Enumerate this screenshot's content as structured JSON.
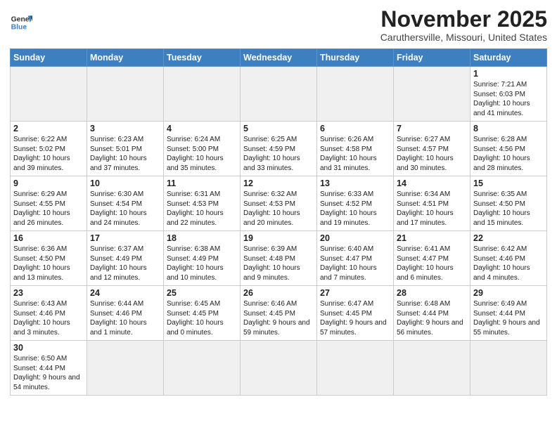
{
  "logo": {
    "line1": "General",
    "line2": "Blue"
  },
  "title": "November 2025",
  "subtitle": "Caruthersville, Missouri, United States",
  "weekdays": [
    "Sunday",
    "Monday",
    "Tuesday",
    "Wednesday",
    "Thursday",
    "Friday",
    "Saturday"
  ],
  "weeks": [
    [
      {
        "day": "",
        "info": ""
      },
      {
        "day": "",
        "info": ""
      },
      {
        "day": "",
        "info": ""
      },
      {
        "day": "",
        "info": ""
      },
      {
        "day": "",
        "info": ""
      },
      {
        "day": "",
        "info": ""
      },
      {
        "day": "1",
        "info": "Sunrise: 7:21 AM\nSunset: 6:03 PM\nDaylight: 10 hours\nand 41 minutes."
      }
    ],
    [
      {
        "day": "2",
        "info": "Sunrise: 6:22 AM\nSunset: 5:02 PM\nDaylight: 10 hours\nand 39 minutes."
      },
      {
        "day": "3",
        "info": "Sunrise: 6:23 AM\nSunset: 5:01 PM\nDaylight: 10 hours\nand 37 minutes."
      },
      {
        "day": "4",
        "info": "Sunrise: 6:24 AM\nSunset: 5:00 PM\nDaylight: 10 hours\nand 35 minutes."
      },
      {
        "day": "5",
        "info": "Sunrise: 6:25 AM\nSunset: 4:59 PM\nDaylight: 10 hours\nand 33 minutes."
      },
      {
        "day": "6",
        "info": "Sunrise: 6:26 AM\nSunset: 4:58 PM\nDaylight: 10 hours\nand 31 minutes."
      },
      {
        "day": "7",
        "info": "Sunrise: 6:27 AM\nSunset: 4:57 PM\nDaylight: 10 hours\nand 30 minutes."
      },
      {
        "day": "8",
        "info": "Sunrise: 6:28 AM\nSunset: 4:56 PM\nDaylight: 10 hours\nand 28 minutes."
      }
    ],
    [
      {
        "day": "9",
        "info": "Sunrise: 6:29 AM\nSunset: 4:55 PM\nDaylight: 10 hours\nand 26 minutes."
      },
      {
        "day": "10",
        "info": "Sunrise: 6:30 AM\nSunset: 4:54 PM\nDaylight: 10 hours\nand 24 minutes."
      },
      {
        "day": "11",
        "info": "Sunrise: 6:31 AM\nSunset: 4:53 PM\nDaylight: 10 hours\nand 22 minutes."
      },
      {
        "day": "12",
        "info": "Sunrise: 6:32 AM\nSunset: 4:53 PM\nDaylight: 10 hours\nand 20 minutes."
      },
      {
        "day": "13",
        "info": "Sunrise: 6:33 AM\nSunset: 4:52 PM\nDaylight: 10 hours\nand 19 minutes."
      },
      {
        "day": "14",
        "info": "Sunrise: 6:34 AM\nSunset: 4:51 PM\nDaylight: 10 hours\nand 17 minutes."
      },
      {
        "day": "15",
        "info": "Sunrise: 6:35 AM\nSunset: 4:50 PM\nDaylight: 10 hours\nand 15 minutes."
      }
    ],
    [
      {
        "day": "16",
        "info": "Sunrise: 6:36 AM\nSunset: 4:50 PM\nDaylight: 10 hours\nand 13 minutes."
      },
      {
        "day": "17",
        "info": "Sunrise: 6:37 AM\nSunset: 4:49 PM\nDaylight: 10 hours\nand 12 minutes."
      },
      {
        "day": "18",
        "info": "Sunrise: 6:38 AM\nSunset: 4:49 PM\nDaylight: 10 hours\nand 10 minutes."
      },
      {
        "day": "19",
        "info": "Sunrise: 6:39 AM\nSunset: 4:48 PM\nDaylight: 10 hours\nand 9 minutes."
      },
      {
        "day": "20",
        "info": "Sunrise: 6:40 AM\nSunset: 4:47 PM\nDaylight: 10 hours\nand 7 minutes."
      },
      {
        "day": "21",
        "info": "Sunrise: 6:41 AM\nSunset: 4:47 PM\nDaylight: 10 hours\nand 6 minutes."
      },
      {
        "day": "22",
        "info": "Sunrise: 6:42 AM\nSunset: 4:46 PM\nDaylight: 10 hours\nand 4 minutes."
      }
    ],
    [
      {
        "day": "23",
        "info": "Sunrise: 6:43 AM\nSunset: 4:46 PM\nDaylight: 10 hours\nand 3 minutes."
      },
      {
        "day": "24",
        "info": "Sunrise: 6:44 AM\nSunset: 4:46 PM\nDaylight: 10 hours\nand 1 minute."
      },
      {
        "day": "25",
        "info": "Sunrise: 6:45 AM\nSunset: 4:45 PM\nDaylight: 10 hours\nand 0 minutes."
      },
      {
        "day": "26",
        "info": "Sunrise: 6:46 AM\nSunset: 4:45 PM\nDaylight: 9 hours\nand 59 minutes."
      },
      {
        "day": "27",
        "info": "Sunrise: 6:47 AM\nSunset: 4:45 PM\nDaylight: 9 hours\nand 57 minutes."
      },
      {
        "day": "28",
        "info": "Sunrise: 6:48 AM\nSunset: 4:44 PM\nDaylight: 9 hours\nand 56 minutes."
      },
      {
        "day": "29",
        "info": "Sunrise: 6:49 AM\nSunset: 4:44 PM\nDaylight: 9 hours\nand 55 minutes."
      }
    ],
    [
      {
        "day": "30",
        "info": "Sunrise: 6:50 AM\nSunset: 4:44 PM\nDaylight: 9 hours\nand 54 minutes."
      },
      {
        "day": "",
        "info": ""
      },
      {
        "day": "",
        "info": ""
      },
      {
        "day": "",
        "info": ""
      },
      {
        "day": "",
        "info": ""
      },
      {
        "day": "",
        "info": ""
      },
      {
        "day": "",
        "info": ""
      }
    ]
  ]
}
